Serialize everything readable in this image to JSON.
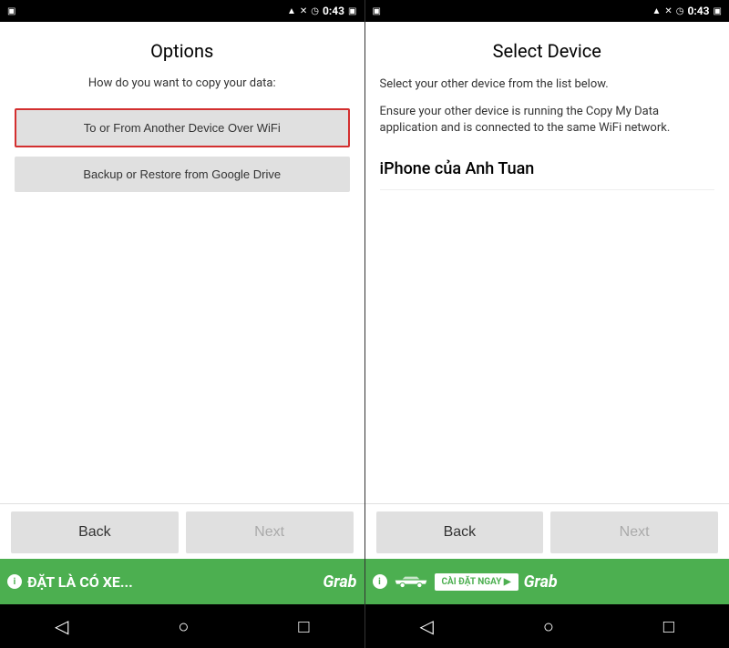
{
  "panel_left": {
    "status_time": "0:43",
    "title": "Options",
    "subtitle": "How do you want to copy your data:",
    "button_wifi": "To or From Another Device Over WiFi",
    "button_google": "Backup or Restore from Google Drive",
    "btn_back": "Back",
    "btn_next": "Next",
    "wifi_selected": true
  },
  "panel_right": {
    "status_time": "0:43",
    "title": "Select Device",
    "description1": "Select your other device from the list below.",
    "description2": "Ensure your other device is running the Copy My Data application and is connected to the same WiFi network.",
    "device_name": "iPhone của Anh Tuan",
    "btn_back": "Back",
    "btn_next": "Next"
  },
  "ad_left": {
    "text": "ĐẶT LÀ CÓ XE...",
    "logo": "Grab"
  },
  "ad_right": {
    "cta": "CÀI ĐẶT NGAY ▶",
    "logo": "Grab"
  },
  "nav": {
    "back": "◁",
    "home": "○",
    "recent": "□"
  },
  "colors": {
    "selected_border": "#d32f2f",
    "grab_green": "#4caf50",
    "nav_bg": "#000000"
  }
}
